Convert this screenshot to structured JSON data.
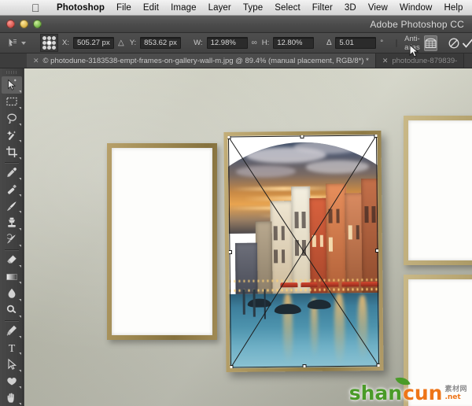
{
  "menubar": {
    "apple_icon": "apple-logo",
    "items": [
      {
        "label": "Photoshop",
        "bold": true
      },
      {
        "label": "File",
        "bold": false
      },
      {
        "label": "Edit",
        "bold": false
      },
      {
        "label": "Image",
        "bold": false
      },
      {
        "label": "Layer",
        "bold": false
      },
      {
        "label": "Type",
        "bold": false
      },
      {
        "label": "Select",
        "bold": false
      },
      {
        "label": "Filter",
        "bold": false
      },
      {
        "label": "3D",
        "bold": false
      },
      {
        "label": "View",
        "bold": false
      },
      {
        "label": "Window",
        "bold": false
      },
      {
        "label": "Help",
        "bold": false
      }
    ]
  },
  "titlebar": {
    "app_title": "Adobe Photoshop CC",
    "close_tooltip": "Close",
    "minimize_tooltip": "Minimize",
    "zoom_tooltip": "Zoom"
  },
  "options_bar": {
    "tool_preset_icon": "move-tool-preset-icon",
    "reference_point_label": "reference-point-grid",
    "x_label": "X:",
    "x_value": "505.27 px",
    "delta_icon": "delta-relative-icon",
    "y_label": "Y:",
    "y_value": "853.62 px",
    "w_label": "W:",
    "w_value": "12.98%",
    "link_icon": "link-aspect-icon",
    "h_label": "H:",
    "h_value": "12.80%",
    "angle_icon": "angle-icon",
    "angle_value": "5.01",
    "angle_unit": "°",
    "anti_alias_label": "Anti-alias",
    "anti_alias_checked": false,
    "warp_button": "warp-mode-icon",
    "cancel_button": "cancel-transform-icon",
    "commit_button": "commit-transform-icon"
  },
  "tabs": [
    {
      "title": "© photodune-3183538-empt-frames-on-gallery-wall-m.jpg @ 89.4% (manual placement, RGB/8*) *",
      "close_icon": "close-tab-icon",
      "active": true
    },
    {
      "title": "photodune-879839-",
      "close_icon": "close-tab-icon",
      "active": false
    }
  ],
  "toolbar": {
    "tools": [
      {
        "name": "move-tool",
        "glyph": "move",
        "active": true,
        "has_flyout": true
      },
      {
        "name": "rectangular-marquee-tool",
        "glyph": "marquee",
        "active": false,
        "has_flyout": true
      },
      {
        "name": "lasso-tool",
        "glyph": "lasso",
        "active": false,
        "has_flyout": true
      },
      {
        "name": "magic-wand-tool",
        "glyph": "wand",
        "active": false,
        "has_flyout": true
      },
      {
        "name": "crop-tool",
        "glyph": "crop",
        "active": false,
        "has_flyout": true
      },
      {
        "name": "eyedropper-tool",
        "glyph": "eyedropper",
        "active": false,
        "has_flyout": true
      },
      {
        "name": "spot-healing-brush-tool",
        "glyph": "healing",
        "active": false,
        "has_flyout": true
      },
      {
        "name": "brush-tool",
        "glyph": "brush",
        "active": false,
        "has_flyout": true
      },
      {
        "name": "clone-stamp-tool",
        "glyph": "stamp",
        "active": false,
        "has_flyout": true
      },
      {
        "name": "history-brush-tool",
        "glyph": "historybrush",
        "active": false,
        "has_flyout": true
      },
      {
        "name": "eraser-tool",
        "glyph": "eraser",
        "active": false,
        "has_flyout": true
      },
      {
        "name": "gradient-tool",
        "glyph": "gradient",
        "active": false,
        "has_flyout": true
      },
      {
        "name": "blur-tool",
        "glyph": "blur",
        "active": false,
        "has_flyout": true
      },
      {
        "name": "dodge-tool",
        "glyph": "dodge",
        "active": false,
        "has_flyout": true
      },
      {
        "name": "pen-tool",
        "glyph": "pen",
        "active": false,
        "has_flyout": true
      },
      {
        "name": "type-tool",
        "glyph": "type",
        "active": false,
        "has_flyout": true
      },
      {
        "name": "path-selection-tool",
        "glyph": "pathselect",
        "active": false,
        "has_flyout": true
      },
      {
        "name": "custom-shape-tool",
        "glyph": "shape",
        "active": false,
        "has_flyout": true
      },
      {
        "name": "hand-tool",
        "glyph": "hand",
        "active": false,
        "has_flyout": true
      }
    ]
  },
  "canvas": {
    "document_name": "photodune-3183538-empt-frames-on-gallery-wall-m.jpg",
    "zoom_level": "89.4%",
    "color_mode": "RGB/8*",
    "state_label": "manual placement",
    "artwork_description": "Venice grand canal at sunset placed into gallery frame",
    "transform_active": true,
    "frames": [
      {
        "name": "empty-frame-left",
        "state": "empty"
      },
      {
        "name": "artwork-frame-center",
        "state": "filled"
      },
      {
        "name": "empty-frame-right-top",
        "state": "empty"
      },
      {
        "name": "empty-frame-right-bottom",
        "state": "empty"
      }
    ]
  },
  "watermark": {
    "part1": "shan",
    "part2": "cun",
    "cn_text": "素材网",
    "domain": ".net"
  }
}
